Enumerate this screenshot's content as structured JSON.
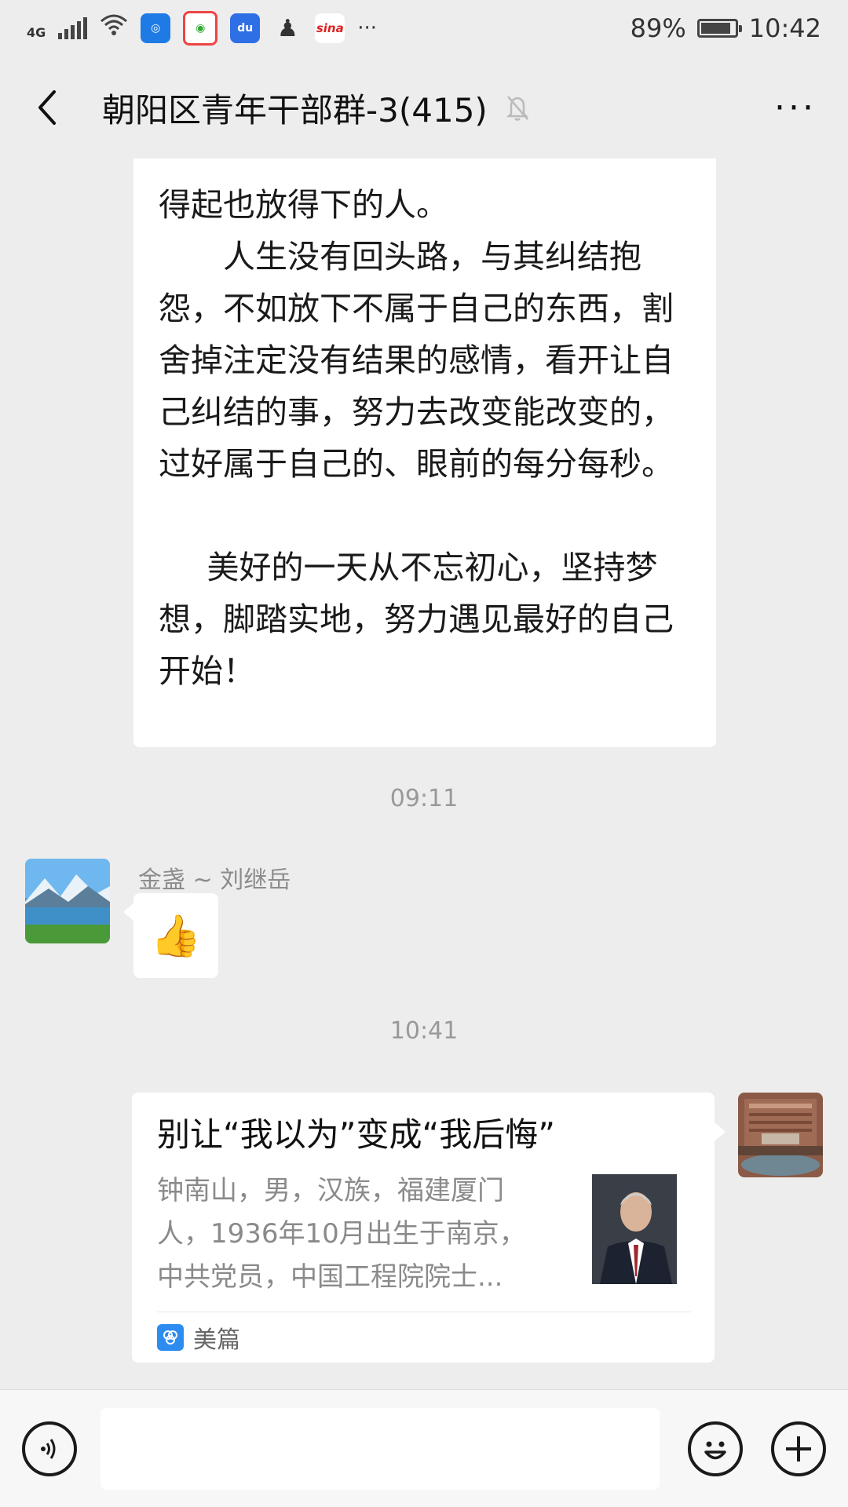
{
  "status_bar": {
    "network": "4G",
    "battery_percent": "89%",
    "battery_level": 0.89,
    "time": "10:42",
    "more": "···",
    "app_icons": [
      "wifi-icon",
      "app-icon-blue",
      "app-icon-browser",
      "baidu-icon",
      "qq-icon",
      "sina-icon"
    ]
  },
  "header": {
    "title": "朝阳区青年干部群-3(415)",
    "back_icon": "chevron-left-icon",
    "mute_icon": "bell-off-icon",
    "more_icon": "more-icon",
    "more_label": "···"
  },
  "messages": {
    "long_text": {
      "line0": "得起也放得下的人。",
      "para1": "人生没有回头路，与其纠结抱怨，不如放下不属于自己的东西，割舍掉注定没有结果的感情，看开让自己纠结的事，努力去改变能改变的，过好属于自己的、眼前的每分每秒。",
      "para2": "美好的一天从不忘初心，坚持梦想，脚踏实地，努力遇见最好的自己开始！"
    },
    "time1": "09:11",
    "msg1": {
      "sender": "金盏 ~ 刘继岳",
      "content": "👍",
      "content_icon": "thumbs-up-icon"
    },
    "time2": "10:41",
    "link_card": {
      "title": "别让“我以为”变成“我后悔”",
      "description": "钟南山，男，汉族，福建厦门人，1936年10月出生于南京，中共党员，中国工程院院士...",
      "source": "美篇",
      "source_icon": "meipian-logo-icon"
    }
  },
  "input_bar": {
    "voice_icon": "voice-icon",
    "input_value": "",
    "emoji_icon": "emoji-icon",
    "plus_icon": "plus-icon"
  },
  "colors": {
    "background": "#ededed",
    "bubble": "#ffffff",
    "meta_text": "#999999"
  }
}
